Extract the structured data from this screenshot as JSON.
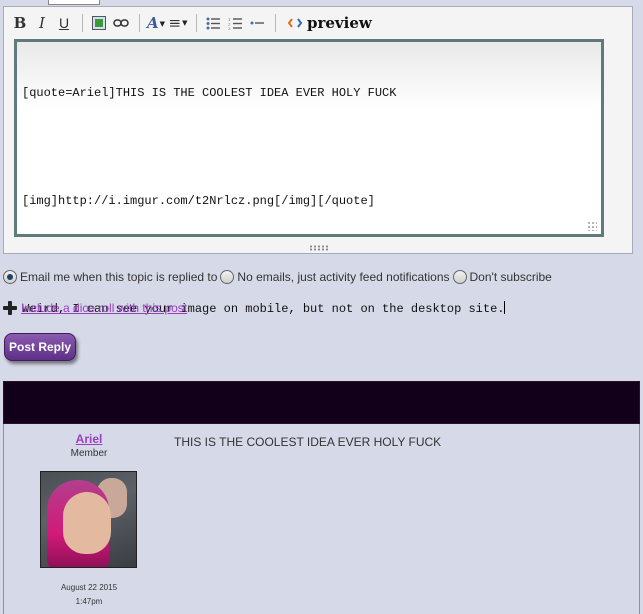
{
  "toolbar": {
    "bold": "B",
    "italic": "I",
    "underline": "U",
    "font_label": "A",
    "align_label": "≡",
    "preview_label": "preview"
  },
  "editor": {
    "lines": [
      "[quote=Ariel]THIS IS THE COOLEST IDEA EVER HOLY FUCK",
      "",
      "[img]http://i.imgur.com/t2Nrlcz.png[/img][/quote]",
      "",
      "Weird, I can see your image on mobile, but not on the desktop site."
    ]
  },
  "subscribe": {
    "options": [
      {
        "label": "Email me when this topic is replied to",
        "selected": true
      },
      {
        "label": "No emails, just activity feed notifications",
        "selected": false
      },
      {
        "label": "Don't subscribe",
        "selected": false
      }
    ]
  },
  "dice": {
    "link_text": "Include a dice roll with this post"
  },
  "post_button": "Post Reply",
  "post": {
    "author": "Ariel",
    "rank": "Member",
    "date": "August 22 2015",
    "time": "1:47pm",
    "text": "THIS IS THE COOLEST IDEA EVER HOLY FUCK"
  },
  "colors": {
    "page_bg": "#d6d9e8",
    "link": "#9a3fbf",
    "button": "#6b3d98",
    "header_band": "#12001a"
  }
}
